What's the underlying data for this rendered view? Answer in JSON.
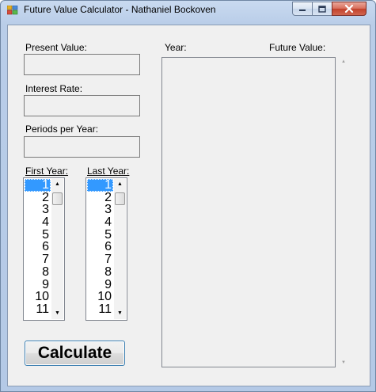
{
  "window": {
    "title": "Future Value Calculator - Nathaniel Bockoven",
    "minimize_icon": "minimize-icon",
    "maximize_icon": "maximize-icon",
    "close_icon": "close-icon"
  },
  "form": {
    "present_value_label": "Present Value:",
    "present_value": "",
    "interest_rate_label": "Interest Rate:",
    "interest_rate": "",
    "periods_label": "Periods per Year:",
    "periods": "",
    "first_year_label": "First Year:",
    "last_year_label": "Last Year:",
    "first_year_items": [
      "1",
      "2",
      "3",
      "4",
      "5",
      "6",
      "7",
      "8",
      "9",
      "10",
      "11"
    ],
    "last_year_items": [
      "1",
      "2",
      "3",
      "4",
      "5",
      "6",
      "7",
      "8",
      "9",
      "10",
      "11"
    ],
    "first_year_selected": "1",
    "last_year_selected": "1",
    "calculate_label": "Calculate"
  },
  "results": {
    "year_header": "Year:",
    "future_value_header": "Future Value:"
  },
  "colors": {
    "selection": "#3399ff",
    "close_button": "#c2412b",
    "window_frame": "#b9cde8",
    "client_bg": "#f0f0f0"
  }
}
